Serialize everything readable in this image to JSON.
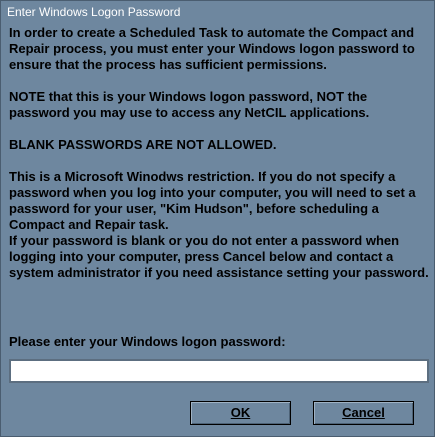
{
  "window": {
    "title": "Enter Windows Logon Password"
  },
  "message": {
    "p1": "In order to create a Scheduled Task to automate the Compact and Repair process, you must enter your Windows logon password to ensure that the process has sufficient permissions.",
    "p2": "NOTE that this is your Windows logon password, NOT the password you may use to access any NetCIL applications.",
    "p3": "BLANK PASSWORDS ARE NOT ALLOWED.",
    "p4": "This is a Microsoft Winodws restriction.  If you do not specify a password when you log into your computer, you will need to set a password for your user, \"Kim Hudson\", before scheduling a Compact and Repair task.",
    "p5": "If your password is blank or you do not enter a password when logging into your computer, press Cancel below and contact a system administrator if you need assistance setting your password."
  },
  "form": {
    "prompt": "Please enter your Windows logon password:",
    "password_value": ""
  },
  "buttons": {
    "ok_label": "OK",
    "cancel_label": "Cancel"
  }
}
